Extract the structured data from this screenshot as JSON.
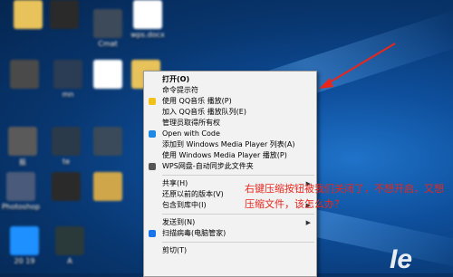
{
  "desktop": {
    "icons": [
      {
        "label": "",
        "color": "#2a2a2a"
      },
      {
        "label": "Cmat",
        "color": "#3d4a5a"
      },
      {
        "label": "wps.docx",
        "color": "#ffffff"
      },
      {
        "label": "",
        "color": "#e8c25a"
      },
      {
        "label": "",
        "color": "#4a4a4a"
      },
      {
        "label": "mn",
        "color": "#2b3c55"
      },
      {
        "label": "",
        "color": "#ffffff"
      },
      {
        "label": "",
        "color": "#e8c25a"
      },
      {
        "label": "抠",
        "color": "#5a5a5a"
      },
      {
        "label": "te",
        "color": "#2a3a4a"
      },
      {
        "label": "",
        "color": "#3a4a5a"
      },
      {
        "label": "Photoshop",
        "color": "#4a5a7a"
      },
      {
        "label": "",
        "color": "#2a2a2a"
      },
      {
        "label": "",
        "color": "#cfa64a"
      },
      {
        "label": "20 19",
        "color": "#1e90ff"
      },
      {
        "label": "A",
        "color": "#2a3a3a"
      }
    ],
    "logo_text": "Ie"
  },
  "context_menu": {
    "items": [
      {
        "label": "打开(O)",
        "bold": true,
        "icon": "",
        "icon_color": "",
        "arrow": false
      },
      {
        "label": "命令提示符",
        "bold": false,
        "icon": "",
        "icon_color": "",
        "arrow": false
      },
      {
        "label": "使用 QQ音乐 播放(P)",
        "bold": false,
        "icon": "qq-music-icon",
        "icon_color": "#f2c21b",
        "arrow": false
      },
      {
        "label": "加入 QQ音乐 播放队列(E)",
        "bold": false,
        "icon": "",
        "icon_color": "",
        "arrow": false
      },
      {
        "label": "管理员取得所有权",
        "bold": false,
        "icon": "",
        "icon_color": "",
        "arrow": false
      },
      {
        "label": "Open with Code",
        "bold": false,
        "icon": "vscode-icon",
        "icon_color": "#1e88e5",
        "arrow": false
      },
      {
        "label": "添加到 Windows Media Player 列表(A)",
        "bold": false,
        "icon": "",
        "icon_color": "",
        "arrow": false
      },
      {
        "label": "使用 Windows Media Player 播放(P)",
        "bold": false,
        "icon": "",
        "icon_color": "",
        "arrow": false
      },
      {
        "label": "WPS网盘-自动同步此文件夹",
        "bold": false,
        "icon": "wps-cloud-icon",
        "icon_color": "#555555",
        "arrow": false,
        "sep_after": true
      },
      {
        "label": "共享(H)",
        "bold": false,
        "icon": "",
        "icon_color": "",
        "arrow": true
      },
      {
        "label": "还原以前的版本(V)",
        "bold": false,
        "icon": "",
        "icon_color": "",
        "arrow": false
      },
      {
        "label": "包含到库中(I)",
        "bold": false,
        "icon": "",
        "icon_color": "",
        "arrow": true,
        "sep_after": true
      },
      {
        "label": "发送到(N)",
        "bold": false,
        "icon": "",
        "icon_color": "",
        "arrow": true
      },
      {
        "label": "扫描病毒(电脑管家)",
        "bold": false,
        "icon": "pc-manager-shield-icon",
        "icon_color": "#1a73e8",
        "arrow": false,
        "sep_after": true
      },
      {
        "label": "剪切(T)",
        "bold": false,
        "icon": "",
        "icon_color": "",
        "arrow": false
      }
    ]
  },
  "annotation": {
    "text": "右键压缩按钮被我们关闭了，不想开启，又想压缩文件，该怎么办？",
    "color": "#e8261c"
  }
}
